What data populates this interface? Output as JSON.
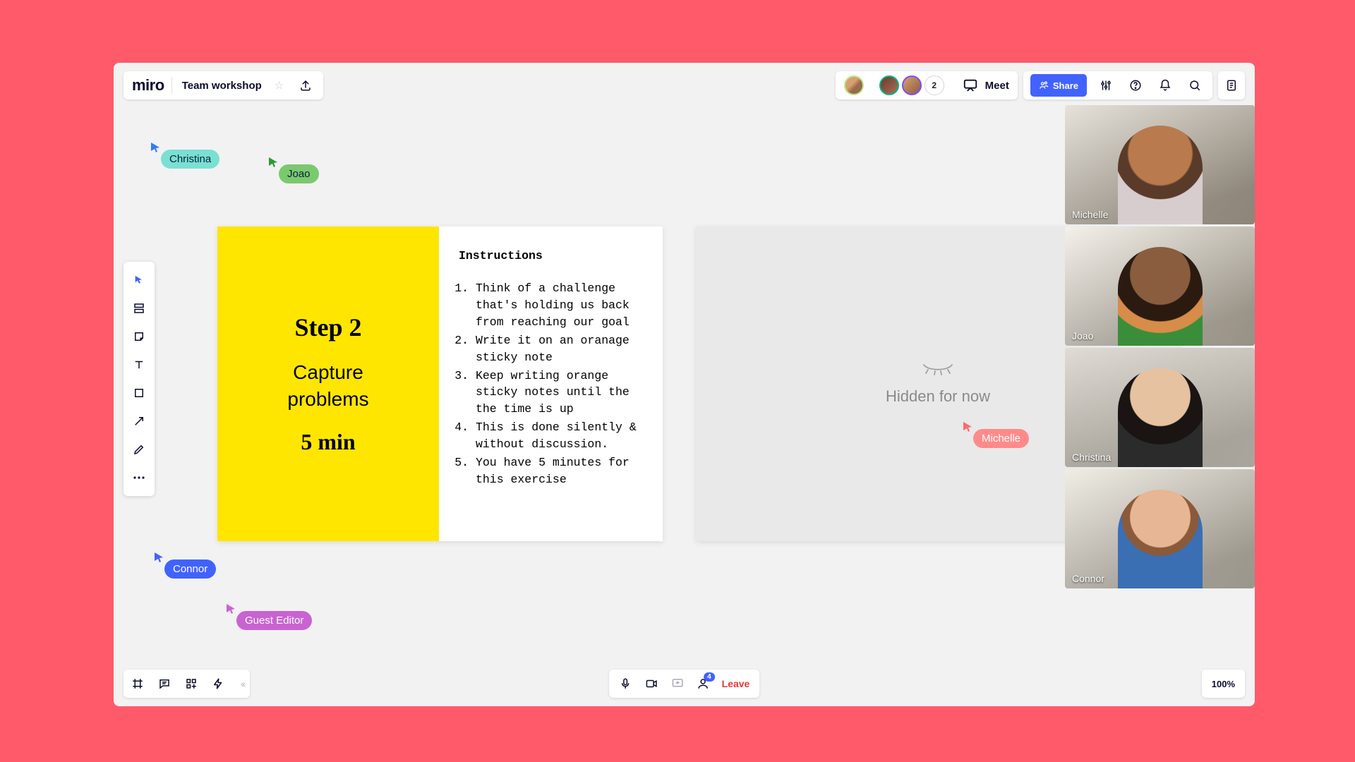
{
  "header": {
    "logo": "miro",
    "board_title": "Team workshop",
    "meet_label": "Meet",
    "share_label": "Share",
    "avatar_count": "2"
  },
  "card": {
    "step": "Step 2",
    "title": "Capture\nproblems",
    "time": "5 min",
    "instructions_title": "Instructions",
    "items": [
      "Think of a challenge that's holding us back from reaching our goal",
      "Write it on an oranage sticky note",
      "Keep writing orange sticky notes until the the time is up",
      "This is done silently & without discussion.",
      "You have 5 minutes for this exercise"
    ]
  },
  "hidden_label": "Hidden for now",
  "cursors": {
    "christina": "Christina",
    "joao": "Joao",
    "connor": "Connor",
    "guest": "Guest Editor",
    "michelle": "Michelle"
  },
  "videos": {
    "v1": "Michelle",
    "v2": "Joao",
    "v3": "Christina",
    "v4": "Connor"
  },
  "meetbar": {
    "count": "4",
    "leave": "Leave"
  },
  "zoom": "100%",
  "colors": {
    "accent": "#4262ff",
    "yellow": "#ffe600",
    "bg": "#ff5a6a"
  }
}
